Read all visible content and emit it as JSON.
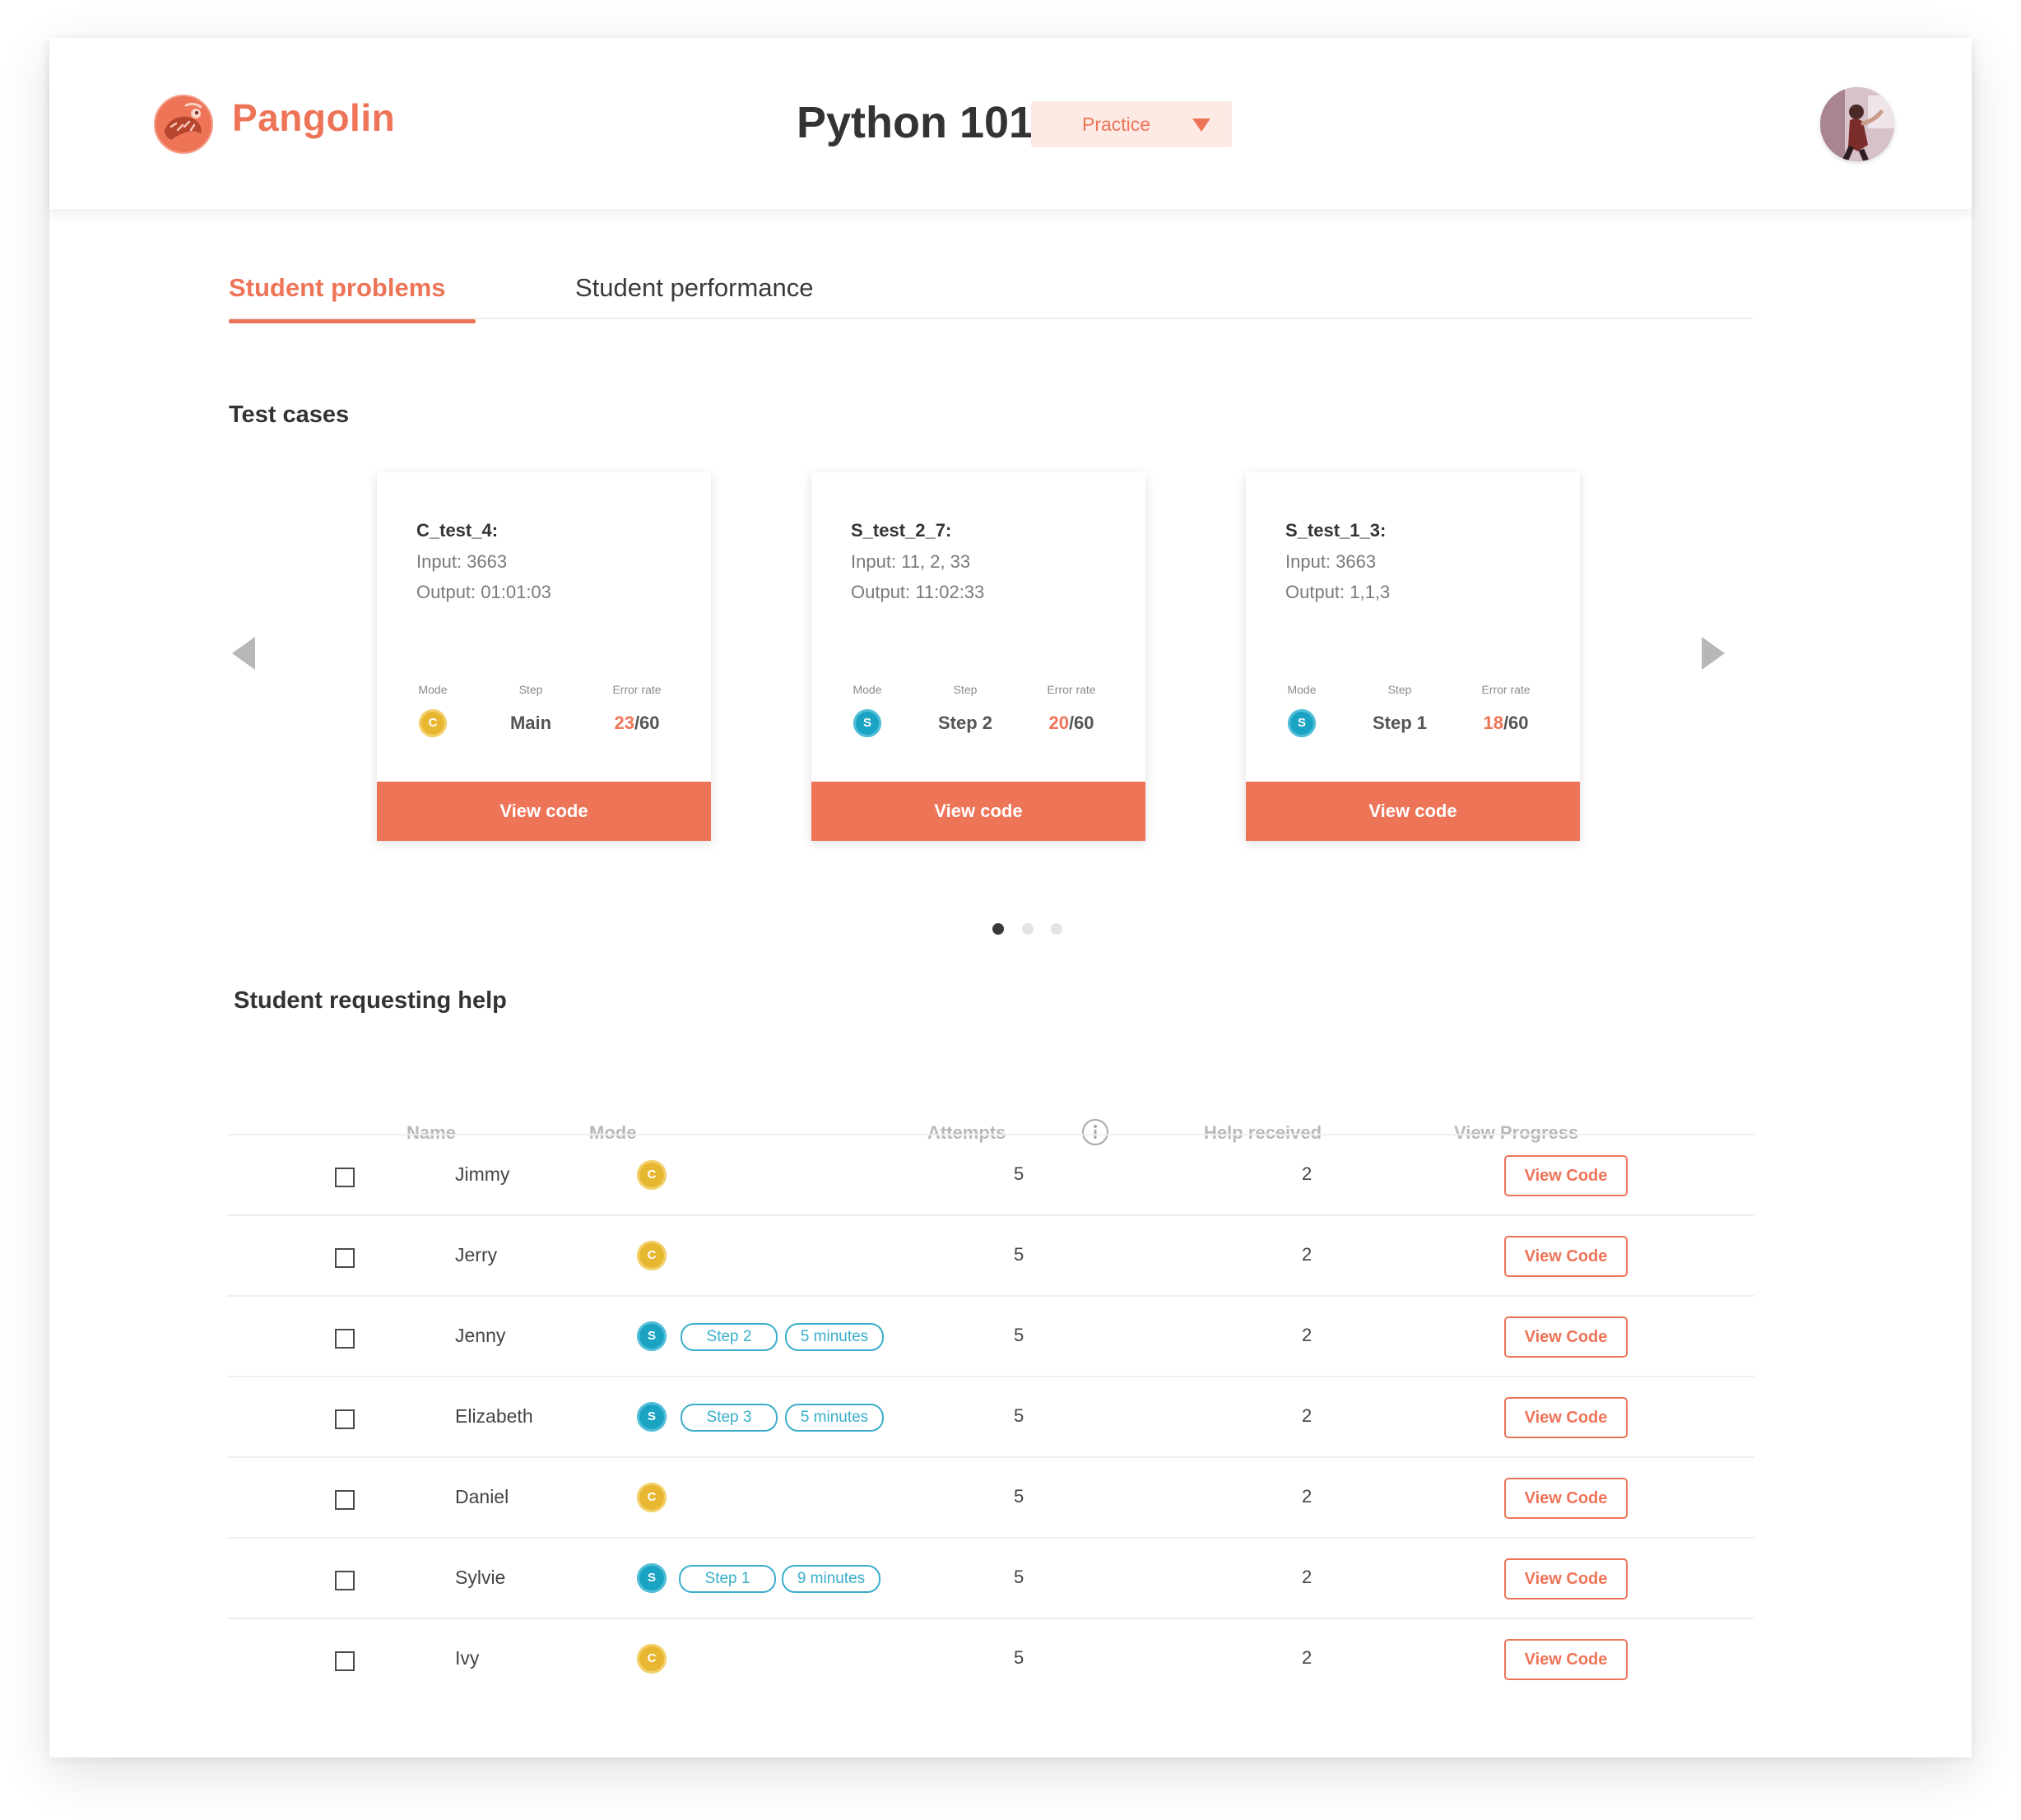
{
  "header": {
    "brand": "Pangolin",
    "course_title": "Python 101",
    "mode_select": "Practice"
  },
  "tabs": [
    {
      "label": "Student problems",
      "active": true
    },
    {
      "label": "Student performance",
      "active": false
    }
  ],
  "test_cases": {
    "title": "Test cases",
    "stat_labels": {
      "mode": "Mode",
      "step": "Step",
      "error_rate": "Error rate"
    },
    "view_label": "View code",
    "cards": [
      {
        "name": "C_test_4:",
        "input": "Input: 3663",
        "output": "Output: 01:01:03",
        "mode": "C",
        "step": "Main",
        "errors": "23",
        "total": "/60"
      },
      {
        "name": "S_test_2_7:",
        "input": "Input: 11, 2, 33",
        "output": "Output: 11:02:33",
        "mode": "S",
        "step": "Step 2",
        "errors": "20",
        "total": "/60"
      },
      {
        "name": "S_test_1_3:",
        "input": "Input: 3663",
        "output": "Output: 1,1,3",
        "mode": "S",
        "step": "Step 1",
        "errors": "18",
        "total": "/60"
      }
    ],
    "pagination": {
      "pages": 3,
      "current": 1
    }
  },
  "help_requests": {
    "title": "Student requesting help",
    "columns": {
      "name": "Name",
      "mode": "Mode",
      "attempts": "Attempts",
      "help_received": "Help received",
      "view_progress": "View Progress"
    },
    "view_label": "View Code",
    "rows": [
      {
        "name": "Jimmy",
        "mode": "C",
        "attempts": "5",
        "help": "2"
      },
      {
        "name": "Jerry",
        "mode": "C",
        "attempts": "5",
        "help": "2"
      },
      {
        "name": "Jenny",
        "mode": "S",
        "step": "Step  2",
        "time": "5 minutes",
        "attempts": "5",
        "help": "2"
      },
      {
        "name": "Elizabeth",
        "mode": "S",
        "step": "Step  3",
        "time": "5 minutes",
        "attempts": "5",
        "help": "2"
      },
      {
        "name": "Daniel",
        "mode": "C",
        "attempts": "5",
        "help": "2"
      },
      {
        "name": "Sylvie",
        "mode": "S",
        "step": "Step  1",
        "time": "9 minutes",
        "attempts": "5",
        "help": "2"
      },
      {
        "name": "Ivy",
        "mode": "C",
        "attempts": "5",
        "help": "2"
      }
    ]
  },
  "colors": {
    "accent": "#ee7458",
    "mode_c": "#e8b731",
    "mode_s": "#1ba3c4"
  },
  "icons": [
    "pangolin-logo-icon",
    "caret-down-icon",
    "user-avatar",
    "arrow-left-icon",
    "arrow-right-icon",
    "info-icon",
    "checkbox-icon"
  ]
}
